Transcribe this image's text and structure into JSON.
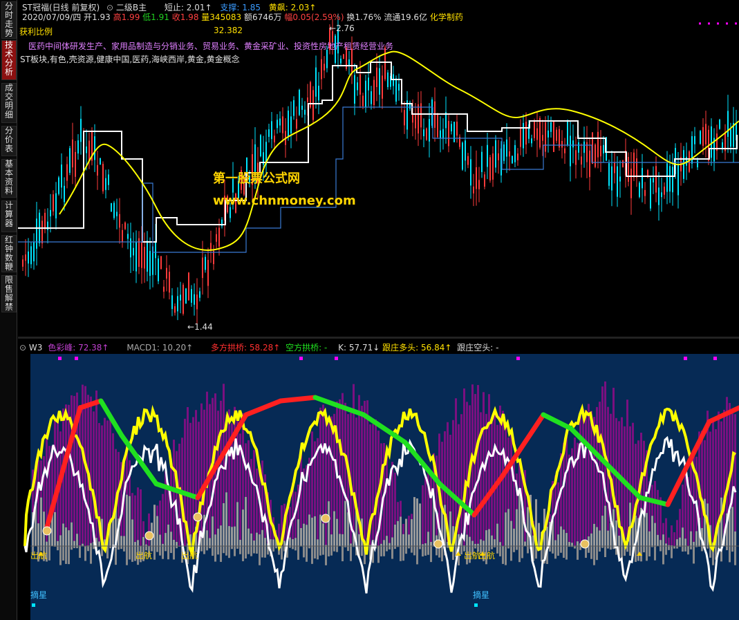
{
  "sidebar": {
    "tabs": [
      {
        "label": "分时走势",
        "active": false
      },
      {
        "label": "技术分析",
        "active": true
      },
      {
        "label": "成交明细",
        "active": false
      },
      {
        "label": "分价表",
        "active": false
      },
      {
        "label": "基本资料",
        "active": false
      },
      {
        "label": "计算器",
        "active": false
      },
      {
        "label": "红钟数鞭",
        "active": false
      },
      {
        "label": "限售解禁",
        "active": false
      }
    ]
  },
  "header": {
    "stock_title": "ST冠福(日线 前复权)",
    "formula_name": "二级B主",
    "short_stop": "短止: 2.01↑",
    "support": "支撑: 1.85",
    "bull_flag": "黄飙: 2.03↑",
    "quote_line": {
      "date": "2020/07/09/四",
      "open": "开1.93",
      "high": "高1.99",
      "low": "低1.91",
      "close": "收1.98",
      "volume": "量345083",
      "amount": "额6746万",
      "change": "幅0.05(2.59%)",
      "turnover": "换1.76%",
      "float": "流通19.6亿",
      "sector": "化学制药"
    },
    "profit_ratio_label": "获利比例",
    "profit_ratio_value": "32.382",
    "business": "医药中间体研发生产、家用品制造与分销业务、贸易业务、黄金采矿业、投资性房地产租赁经营业务",
    "concepts": "ST板块,有色,壳资源,健康中国,医药,海峡西岸,黄金,黄金概念",
    "high_marker": "2.76",
    "low_marker": "1.44"
  },
  "watermark": {
    "line1": "第一股票公式网",
    "line2": "www.chnmoney.com"
  },
  "indicator": {
    "name": "W3",
    "colorful_peak": "色彩峰: 72.38↑",
    "macd1": "MACD1: 10.20↑",
    "bull_arch": "多方拱桥: 58.28↑",
    "bear_arch": "空方拱桥: -",
    "k": "K: 57.71↓",
    "dealer_long": "跟庄多头: 56.84↑",
    "dealer_short": "跟庄空头: -",
    "signal_sail": "出航",
    "signal_star": "摘星"
  },
  "colors": {
    "up": "#ff3b3b",
    "down": "#00e5ff",
    "white_line": "#ffffff",
    "yellow_line": "#ffff00",
    "blue_line": "#3a7bd5",
    "indicator_bg": "#062a55",
    "purple": "#7a1080",
    "magenta": "#ff00ff"
  }
}
